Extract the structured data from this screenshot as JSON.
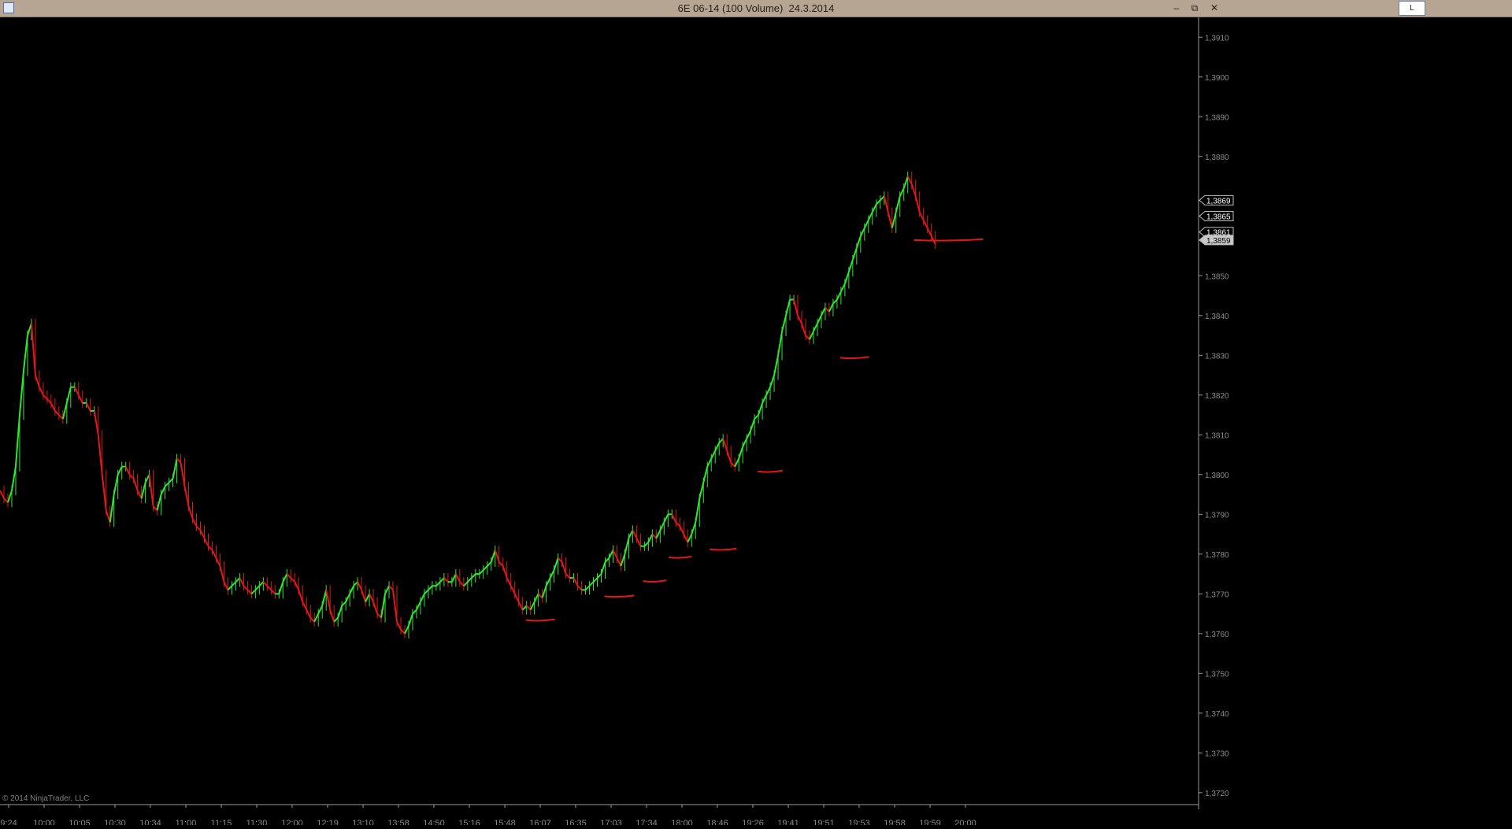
{
  "window": {
    "title": "6E 06-14 (100 Volume)  24.3.2014",
    "link_button": "L",
    "minimize_icon": "minimize-icon",
    "restore_icon": "restore-icon",
    "close_icon": "close-icon"
  },
  "footer": {
    "copyright": "© 2014 NinjaTrader, LLC"
  },
  "chart_data": {
    "type": "line",
    "instrument": "6E 06-14",
    "x_tick_labels": [
      "9:24",
      "10:00",
      "10:05",
      "10:30",
      "10:34",
      "11:00",
      "11:15",
      "11:30",
      "12:00",
      "12:19",
      "13:10",
      "13:58",
      "14:50",
      "15:16",
      "15:48",
      "16:07",
      "16:35",
      "17:03",
      "17:34",
      "18:00",
      "18:46",
      "19:26",
      "19:41",
      "19:51",
      "19:53",
      "19:58",
      "19:59",
      "20:00"
    ],
    "y_tick_labels": [
      "1,3910",
      "1,3900",
      "1,3890",
      "1,3880",
      "1,3850",
      "1,3840",
      "1,3830",
      "1,3820",
      "1,3810",
      "1,3800",
      "1,3790",
      "1,3780",
      "1,3770",
      "1,3760",
      "1,3750",
      "1,3740",
      "1,3730",
      "1,3720"
    ],
    "y_ticks": [
      1.391,
      1.39,
      1.389,
      1.388,
      1.385,
      1.384,
      1.383,
      1.382,
      1.381,
      1.38,
      1.379,
      1.378,
      1.377,
      1.376,
      1.375,
      1.374,
      1.373,
      1.372
    ],
    "ylim": [
      1.3717,
      1.3915
    ],
    "xlim": [
      0,
      1525
    ],
    "price_markers": [
      {
        "label": "1,3869",
        "value": 1.3869
      },
      {
        "label": "1,3865",
        "value": 1.3865
      },
      {
        "label": "1,3861",
        "value": 1.3861
      },
      {
        "label": "1,3859",
        "value": 1.3859
      }
    ],
    "series": [
      {
        "bar_index": [
          0,
          5,
          10,
          15,
          20,
          25,
          30,
          35,
          40,
          45,
          50,
          55,
          60,
          65,
          70,
          75,
          80,
          85,
          90,
          95,
          100,
          105,
          110,
          115,
          120,
          125,
          130,
          135,
          140,
          145,
          150,
          155,
          160,
          165,
          170,
          175,
          180,
          185,
          190,
          195,
          200,
          205,
          210,
          215,
          220,
          225,
          230,
          235,
          240,
          245,
          250,
          255,
          260,
          265,
          270,
          275,
          280,
          285,
          290,
          295,
          300,
          305,
          310,
          315,
          320,
          325,
          330,
          335,
          340,
          345,
          350,
          355,
          360,
          365,
          370,
          375,
          380,
          385,
          390,
          395,
          400,
          405,
          410,
          415,
          420,
          425,
          430,
          435,
          440,
          445,
          450,
          455,
          460,
          465,
          470,
          475,
          480,
          485,
          490,
          495,
          500,
          505,
          510,
          515,
          520,
          525,
          530,
          535,
          540,
          545,
          550,
          555,
          560,
          565,
          570,
          575,
          580,
          585,
          590,
          595,
          600,
          605,
          610,
          615,
          620,
          625,
          630,
          635,
          640,
          645,
          650,
          655,
          660,
          665,
          670,
          675,
          680,
          685,
          690,
          695,
          700,
          705,
          710,
          715,
          720,
          725,
          730,
          735,
          740,
          745,
          750,
          755,
          760,
          765,
          770,
          775,
          780,
          785,
          790,
          795,
          800,
          805,
          810,
          815,
          820,
          825,
          830,
          835,
          840,
          845,
          850,
          855,
          860,
          865,
          870,
          875,
          880,
          885,
          890,
          895,
          900,
          905,
          910,
          915,
          920,
          925,
          930,
          935,
          940,
          945,
          950,
          955,
          960,
          965,
          970,
          975,
          980,
          985,
          990,
          995,
          1000,
          1005,
          1010,
          1015,
          1020,
          1025,
          1030,
          1035,
          1040,
          1045,
          1050,
          1055,
          1060,
          1065,
          1070,
          1075,
          1080,
          1085,
          1090,
          1095,
          1100,
          1105,
          1110,
          1115,
          1120,
          1125,
          1130,
          1135,
          1140,
          1145,
          1150,
          1155,
          1160,
          1165,
          1170,
          1175,
          1180,
          1185,
          1190,
          1195,
          1200,
          1205,
          1210,
          1215,
          1220,
          1225,
          1230
        ],
        "price": [
          1.3796,
          1.3794,
          1.3793,
          1.3796,
          1.3802,
          1.3815,
          1.3826,
          1.3835,
          1.3838,
          1.3825,
          1.3822,
          1.382,
          1.3819,
          1.3818,
          1.3816,
          1.3815,
          1.3814,
          1.3818,
          1.3822,
          1.3822,
          1.382,
          1.3818,
          1.3818,
          1.3816,
          1.3816,
          1.381,
          1.38,
          1.3791,
          1.3788,
          1.3795,
          1.38,
          1.3802,
          1.3802,
          1.38,
          1.3799,
          1.3796,
          1.3794,
          1.3798,
          1.38,
          1.3792,
          1.3791,
          1.3795,
          1.3797,
          1.3798,
          1.3799,
          1.3804,
          1.3803,
          1.3797,
          1.3792,
          1.3789,
          1.3787,
          1.3786,
          1.3784,
          1.3782,
          1.3781,
          1.3779,
          1.3777,
          1.3773,
          1.3771,
          1.3772,
          1.3773,
          1.3774,
          1.3772,
          1.3771,
          1.377,
          1.3771,
          1.3772,
          1.3773,
          1.3772,
          1.3771,
          1.377,
          1.377,
          1.3773,
          1.3775,
          1.3774,
          1.3773,
          1.3771,
          1.3768,
          1.3766,
          1.3764,
          1.3763,
          1.3765,
          1.3767,
          1.3771,
          1.3766,
          1.3763,
          1.3764,
          1.3767,
          1.3768,
          1.377,
          1.3772,
          1.3773,
          1.3771,
          1.3768,
          1.377,
          1.3768,
          1.3765,
          1.3764,
          1.377,
          1.3772,
          1.3771,
          1.3763,
          1.3761,
          1.376,
          1.3762,
          1.3765,
          1.3766,
          1.3768,
          1.377,
          1.3771,
          1.3772,
          1.3772,
          1.3773,
          1.3774,
          1.3773,
          1.3773,
          1.3775,
          1.3773,
          1.3772,
          1.3773,
          1.3774,
          1.3775,
          1.3775,
          1.3776,
          1.3777,
          1.3778,
          1.3781,
          1.3778,
          1.3777,
          1.3774,
          1.3772,
          1.377,
          1.3768,
          1.3766,
          1.3767,
          1.3766,
          1.3768,
          1.377,
          1.3769,
          1.3772,
          1.3774,
          1.3776,
          1.3779,
          1.3778,
          1.3775,
          1.3774,
          1.3774,
          1.3772,
          1.3771,
          1.3771,
          1.3772,
          1.3773,
          1.3774,
          1.3775,
          1.3778,
          1.3779,
          1.3781,
          1.3779,
          1.3777,
          1.378,
          1.3784,
          1.3786,
          1.3784,
          1.3782,
          1.3782,
          1.3783,
          1.3785,
          1.3784,
          1.3786,
          1.3788,
          1.379,
          1.379,
          1.3788,
          1.3787,
          1.3785,
          1.3783,
          1.3785,
          1.3788,
          1.3794,
          1.3798,
          1.3802,
          1.3804,
          1.3806,
          1.3808,
          1.3809,
          1.3806,
          1.3803,
          1.3802,
          1.3804,
          1.3807,
          1.3809,
          1.3811,
          1.3814,
          1.3815,
          1.3818,
          1.382,
          1.3822,
          1.3825,
          1.383,
          1.3836,
          1.384,
          1.3844,
          1.3844,
          1.384,
          1.3838,
          1.3835,
          1.3834,
          1.3836,
          1.3838,
          1.384,
          1.3842,
          1.3841,
          1.3843,
          1.3844,
          1.3846,
          1.3848,
          1.3851,
          1.3854,
          1.3857,
          1.386,
          1.3862,
          1.3864,
          1.3866,
          1.3868,
          1.3869,
          1.387,
          1.3866,
          1.3862,
          1.3866,
          1.387,
          1.3872,
          1.3875,
          1.3873,
          1.387,
          1.3866,
          1.3864,
          1.3862,
          1.386,
          1.3858
        ]
      }
    ],
    "annotations": [
      {
        "x1": 669,
        "x2": 706,
        "y": 1.37634
      },
      {
        "x1": 769,
        "x2": 807,
        "y": 1.37694
      },
      {
        "x1": 818,
        "x2": 848,
        "y": 1.37732
      },
      {
        "x1": 851,
        "x2": 880,
        "y": 1.37792
      },
      {
        "x1": 903,
        "x2": 937,
        "y": 1.37812
      },
      {
        "x1": 964,
        "x2": 996,
        "y": 1.38008
      },
      {
        "x1": 1069,
        "x2": 1106,
        "y": 1.38294
      },
      {
        "x1": 1163,
        "x2": 1251,
        "y": 1.3859
      }
    ]
  }
}
